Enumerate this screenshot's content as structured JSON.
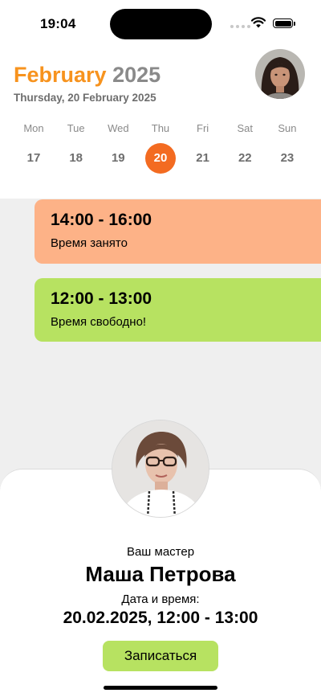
{
  "status_bar": {
    "time": "19:04"
  },
  "header": {
    "month": "February",
    "year": "2025",
    "subtitle": "Thursday, 20 February 2025"
  },
  "week": [
    {
      "name": "Mon",
      "num": "17"
    },
    {
      "name": "Tue",
      "num": "18"
    },
    {
      "name": "Wed",
      "num": "19"
    },
    {
      "name": "Thu",
      "num": "20",
      "selected": true
    },
    {
      "name": "Fri",
      "num": "21"
    },
    {
      "name": "Sat",
      "num": "22"
    },
    {
      "name": "Sun",
      "num": "23"
    }
  ],
  "slots": [
    {
      "time": "14:00 - 16:00",
      "status": "Время занято",
      "color": "#fdb287"
    },
    {
      "time": "12:00 - 13:00",
      "status": "Время свободно!",
      "color": "#b7e261"
    }
  ],
  "card": {
    "master_label": "Ваш мастер",
    "master_name": "Маша Петрова",
    "datetime_label": "Дата и время:",
    "datetime": "20.02.2025, 12:00 - 13:00",
    "book_label": "Записаться"
  },
  "colors": {
    "accent": "#f36b21",
    "month": "#f7931e",
    "busy": "#fdb287",
    "free": "#b7e261"
  }
}
